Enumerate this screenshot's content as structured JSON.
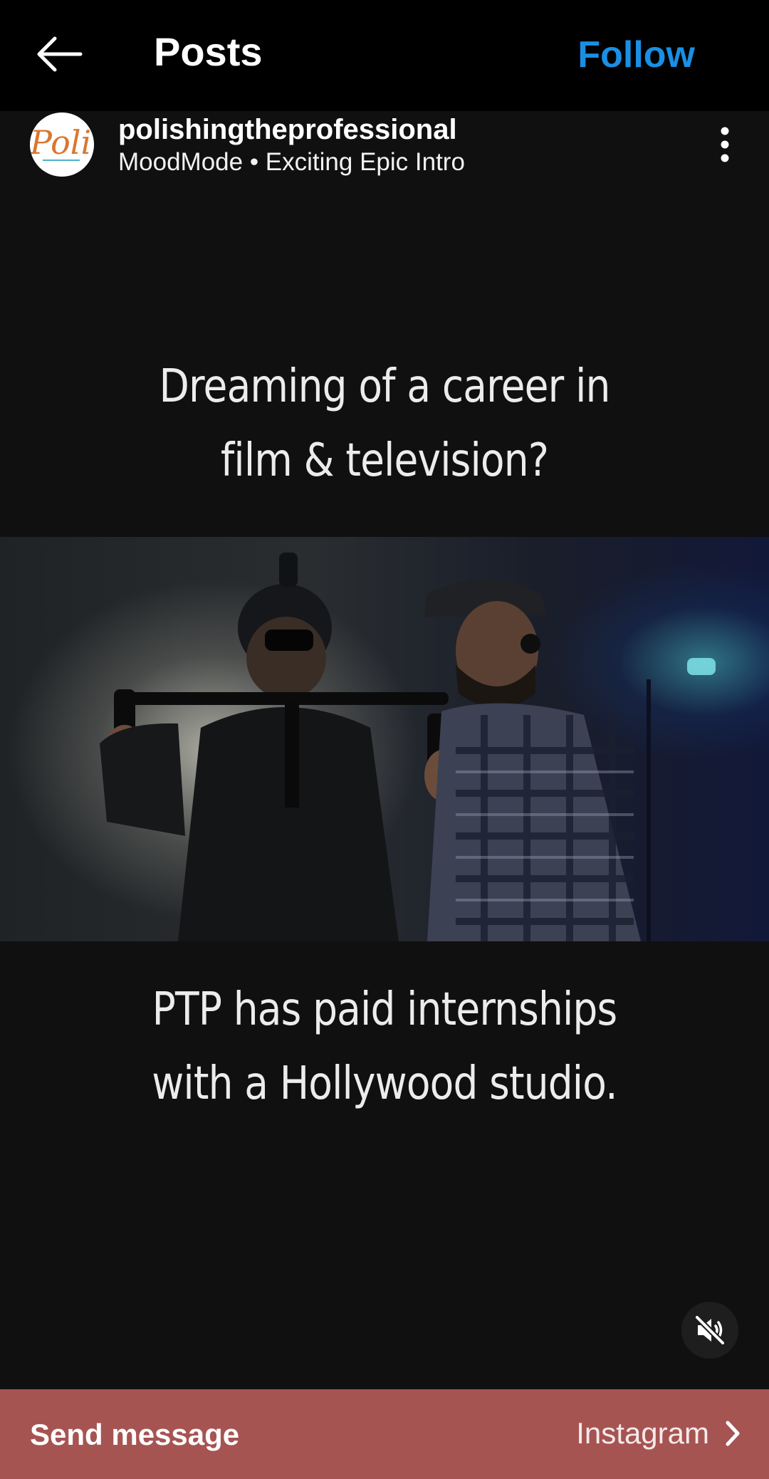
{
  "header": {
    "back_icon": "arrow-left-icon",
    "title": "Posts",
    "follow_label": "Follow",
    "follow_color": "#1a8fe3"
  },
  "post": {
    "username": "polishingtheprofessional",
    "audio": "MoodMode • Exciting Epic Intro",
    "more_icon": "more-vertical-icon"
  },
  "video": {
    "caption_top": [
      "Dreaming of a career in",
      "film & television?"
    ],
    "caption_bottom": [
      "PTP has paid internships",
      "with a Hollywood studio."
    ],
    "mute_icon": "speaker-muted-icon"
  },
  "bottom_bar": {
    "send_label": "Send message",
    "platform_label": "Instagram",
    "chevron_icon": "chevron-right-icon",
    "color": "#a65452"
  }
}
